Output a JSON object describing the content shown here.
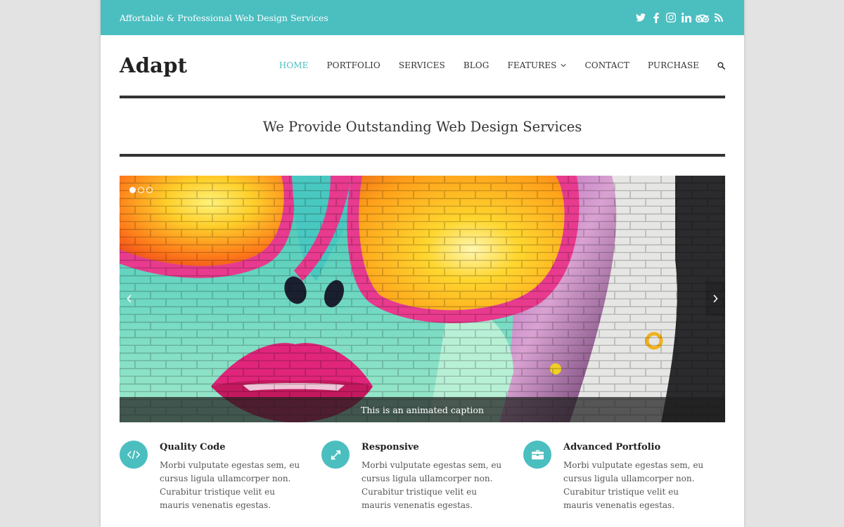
{
  "topbar": {
    "tagline": "Affortable & Professional Web Design Services",
    "accent_color": "#4bbec0",
    "social_icons": [
      "twitter-icon",
      "facebook-icon",
      "instagram-icon",
      "linkedin-icon",
      "tripadvisor-icon",
      "rss-icon"
    ]
  },
  "header": {
    "logo": "Adapt",
    "nav": [
      {
        "label": "HOME",
        "active": true
      },
      {
        "label": "PORTFOLIO"
      },
      {
        "label": "SERVICES"
      },
      {
        "label": "BLOG"
      },
      {
        "label": "FEATURES",
        "has_dropdown": true
      },
      {
        "label": "CONTACT"
      },
      {
        "label": "PURCHASE"
      }
    ],
    "search_icon": "search-icon"
  },
  "hero": {
    "title": "We Provide Outstanding Web Design Services"
  },
  "slider": {
    "caption": "This is an animated caption",
    "slide_count": 3,
    "active_slide": 1
  },
  "features": [
    {
      "title": "Quality Code",
      "icon": "code-icon",
      "text": "Morbi vulputate egestas sem, eu cursus ligula ullamcorper non. Curabitur tristique velit eu mauris venenatis egestas."
    },
    {
      "title": "Responsive",
      "icon": "expand-arrows-icon",
      "text": "Morbi vulputate egestas sem, eu cursus ligula ullamcorper non. Curabitur tristique velit eu mauris venenatis egestas."
    },
    {
      "title": "Advanced Portfolio",
      "icon": "briefcase-icon",
      "text": "Morbi vulputate egestas sem, eu cursus ligula ullamcorper non. Curabitur tristique velit eu mauris venenatis egestas."
    }
  ]
}
